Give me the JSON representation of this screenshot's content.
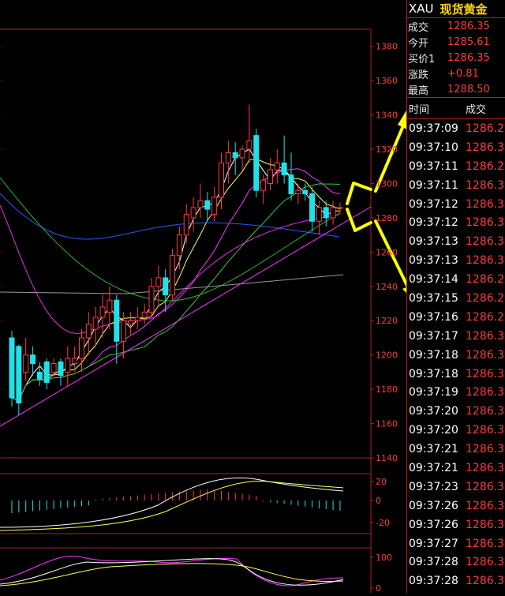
{
  "quote": {
    "symbol": "XAU",
    "name": "现货黄金",
    "rows": [
      {
        "label": "成交",
        "value": "1286.35"
      },
      {
        "label": "今开",
        "value": "1285.61"
      },
      {
        "label": "买价1",
        "value": "1286.35"
      },
      {
        "label": "涨跌",
        "value": "+0.81"
      },
      {
        "label": "最高",
        "value": "1288.50"
      }
    ]
  },
  "ticks_header": {
    "time": "时间",
    "price": "成交"
  },
  "ticks": [
    {
      "time": "09:37:09",
      "price": "1286.2"
    },
    {
      "time": "09:37:10",
      "price": "1286.3"
    },
    {
      "time": "09:37:11",
      "price": "1286.2"
    },
    {
      "time": "09:37:11",
      "price": "1286.3"
    },
    {
      "time": "09:37:12",
      "price": "1286.3"
    },
    {
      "time": "09:37:12",
      "price": "1286.3"
    },
    {
      "time": "09:37:13",
      "price": "1286.3"
    },
    {
      "time": "09:37:13",
      "price": "1286.3"
    },
    {
      "time": "09:37:14",
      "price": "1286.2"
    },
    {
      "time": "09:37:15",
      "price": "1286.2"
    },
    {
      "time": "09:37:16",
      "price": "1286.2"
    },
    {
      "time": "09:37:17",
      "price": "1286.3"
    },
    {
      "time": "09:37:18",
      "price": "1286.3"
    },
    {
      "time": "09:37:18",
      "price": "1286.3"
    },
    {
      "time": "09:37:19",
      "price": "1286.3"
    },
    {
      "time": "09:37:20",
      "price": "1286.3"
    },
    {
      "time": "09:37:20",
      "price": "1286.3"
    },
    {
      "time": "09:37:21",
      "price": "1286.3"
    },
    {
      "time": "09:37:21",
      "price": "1286.3"
    },
    {
      "time": "09:37:23",
      "price": "1286.3"
    },
    {
      "time": "09:37:26",
      "price": "1286.3"
    },
    {
      "time": "09:37:26",
      "price": "1286.3"
    },
    {
      "time": "09:37:27",
      "price": "1286.3"
    },
    {
      "time": "09:37:28",
      "price": "1286.3"
    },
    {
      "time": "09:37:28",
      "price": "1286.3"
    }
  ],
  "colors": {
    "up": "#ff3b3b",
    "down": "#22e0e8",
    "border": "#b02020",
    "arrow": "#ffff00"
  },
  "chart_data": [
    {
      "type": "candlestick",
      "y_ticks": [
        1140,
        1160,
        1180,
        1200,
        1220,
        1240,
        1260,
        1280,
        1300,
        1320,
        1340,
        1360,
        1380
      ],
      "ylim": [
        1140,
        1390
      ],
      "candles": [
        [
          1210,
          1214,
          1170,
          1175
        ],
        [
          1205,
          1206,
          1165,
          1172
        ],
        [
          1190,
          1210,
          1185,
          1200
        ],
        [
          1200,
          1205,
          1188,
          1195
        ],
        [
          1190,
          1196,
          1182,
          1186
        ],
        [
          1196,
          1198,
          1180,
          1184
        ],
        [
          1190,
          1198,
          1188,
          1195
        ],
        [
          1196,
          1198,
          1182,
          1188
        ],
        [
          1190,
          1205,
          1182,
          1198
        ],
        [
          1195,
          1205,
          1190,
          1198
        ],
        [
          1198,
          1215,
          1190,
          1210
        ],
        [
          1210,
          1225,
          1200,
          1218
        ],
        [
          1215,
          1228,
          1205,
          1222
        ],
        [
          1222,
          1235,
          1210,
          1228
        ],
        [
          1225,
          1240,
          1215,
          1232
        ],
        [
          1232,
          1235,
          1195,
          1208
        ],
        [
          1208,
          1225,
          1198,
          1220
        ],
        [
          1218,
          1225,
          1212,
          1220
        ],
        [
          1220,
          1228,
          1215,
          1222
        ],
        [
          1222,
          1230,
          1218,
          1225
        ],
        [
          1225,
          1245,
          1222,
          1240
        ],
        [
          1240,
          1252,
          1228,
          1245
        ],
        [
          1245,
          1250,
          1225,
          1235
        ],
        [
          1235,
          1262,
          1232,
          1258
        ],
        [
          1258,
          1275,
          1250,
          1270
        ],
        [
          1270,
          1288,
          1265,
          1282
        ],
        [
          1280,
          1292,
          1272,
          1286
        ],
        [
          1286,
          1300,
          1280,
          1290
        ],
        [
          1290,
          1295,
          1278,
          1285
        ],
        [
          1282,
          1298,
          1278,
          1292
        ],
        [
          1292,
          1318,
          1285,
          1312
        ],
        [
          1312,
          1325,
          1300,
          1318
        ],
        [
          1318,
          1324,
          1305,
          1315
        ],
        [
          1315,
          1322,
          1308,
          1320
        ],
        [
          1320,
          1346,
          1312,
          1325
        ],
        [
          1328,
          1332,
          1292,
          1296
        ],
        [
          1296,
          1305,
          1288,
          1302
        ],
        [
          1300,
          1315,
          1296,
          1308
        ],
        [
          1308,
          1320,
          1300,
          1312
        ],
        [
          1312,
          1328,
          1300,
          1305
        ],
        [
          1305,
          1318,
          1290,
          1294
        ],
        [
          1294,
          1300,
          1288,
          1296
        ],
        [
          1296,
          1300,
          1290,
          1294
        ],
        [
          1294,
          1298,
          1272,
          1278
        ],
        [
          1278,
          1290,
          1270,
          1286
        ],
        [
          1286,
          1290,
          1275,
          1280
        ],
        [
          1280,
          1290,
          1276,
          1286
        ],
        [
          1286,
          1289,
          1282,
          1286
        ]
      ]
    },
    {
      "type": "bar",
      "name": "macd",
      "y_ticks": [
        20,
        0,
        -20
      ],
      "ylim": [
        -25,
        25
      ]
    },
    {
      "type": "line",
      "name": "kdj",
      "y_ticks": [
        100,
        0
      ],
      "ylim": [
        0,
        110
      ]
    }
  ]
}
